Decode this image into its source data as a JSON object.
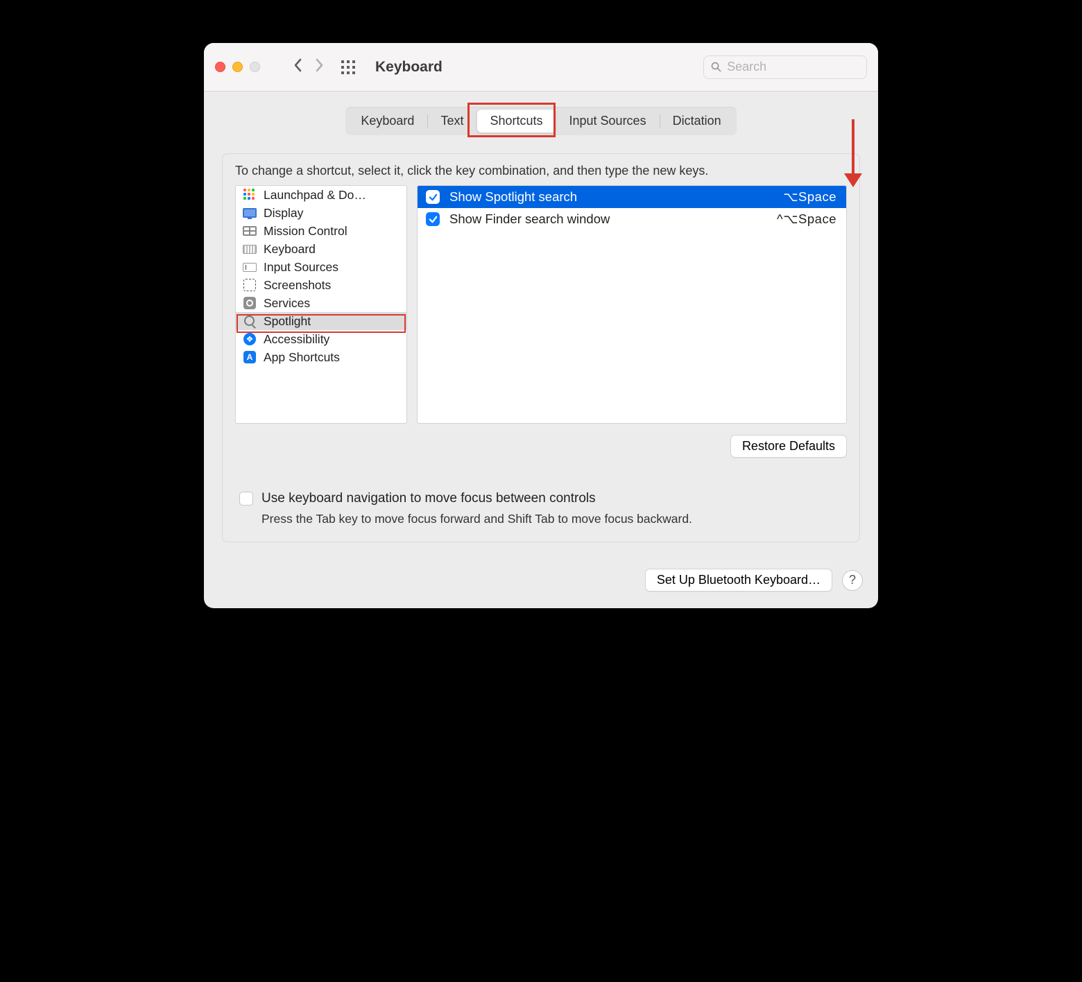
{
  "window": {
    "title": "Keyboard"
  },
  "search": {
    "placeholder": "Search",
    "value": ""
  },
  "tabs": [
    {
      "label": "Keyboard",
      "active": false
    },
    {
      "label": "Text",
      "active": false
    },
    {
      "label": "Shortcuts",
      "active": true
    },
    {
      "label": "Input Sources",
      "active": false
    },
    {
      "label": "Dictation",
      "active": false
    }
  ],
  "hint": "To change a shortcut, select it, click the key combination, and then type the new keys.",
  "categories": [
    {
      "label": "Launchpad & Do…",
      "icon": "launchpad-icon",
      "selected": false
    },
    {
      "label": "Display",
      "icon": "display-icon",
      "selected": false
    },
    {
      "label": "Mission Control",
      "icon": "mission-control-icon",
      "selected": false
    },
    {
      "label": "Keyboard",
      "icon": "keyboard-icon",
      "selected": false
    },
    {
      "label": "Input Sources",
      "icon": "input-sources-icon",
      "selected": false
    },
    {
      "label": "Screenshots",
      "icon": "screenshots-icon",
      "selected": false
    },
    {
      "label": "Services",
      "icon": "gear-icon",
      "selected": false
    },
    {
      "label": "Spotlight",
      "icon": "magnifier-icon",
      "selected": true
    },
    {
      "label": "Accessibility",
      "icon": "accessibility-icon",
      "selected": false
    },
    {
      "label": "App Shortcuts",
      "icon": "app-icon",
      "selected": false
    }
  ],
  "shortcuts": [
    {
      "checked": true,
      "label": "Show Spotlight search",
      "keys": "⌥Space",
      "selected": true
    },
    {
      "checked": true,
      "label": "Show Finder search window",
      "keys": "^⌥Space",
      "selected": false
    }
  ],
  "buttons": {
    "restore": "Restore Defaults",
    "bluetooth": "Set Up Bluetooth Keyboard…"
  },
  "kbnav": {
    "checked": false,
    "label": "Use keyboard navigation to move focus between controls",
    "desc": "Press the Tab key to move focus forward and Shift Tab to move focus backward."
  },
  "annotation": {
    "color": "#d63a2e"
  }
}
